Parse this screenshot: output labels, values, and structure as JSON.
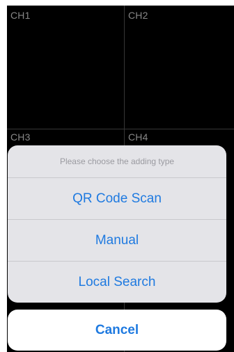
{
  "channels": [
    {
      "label": "CH1"
    },
    {
      "label": "CH2"
    },
    {
      "label": "CH3"
    },
    {
      "label": "CH4"
    }
  ],
  "action_sheet": {
    "title": "Please choose the adding type",
    "options": [
      {
        "label": "QR Code Scan"
      },
      {
        "label": "Manual"
      },
      {
        "label": "Local Search"
      }
    ],
    "cancel_label": "Cancel"
  },
  "colors": {
    "accent": "#1f7ae0",
    "sheet_background": "#e4e4e8",
    "video_background": "#000000"
  }
}
